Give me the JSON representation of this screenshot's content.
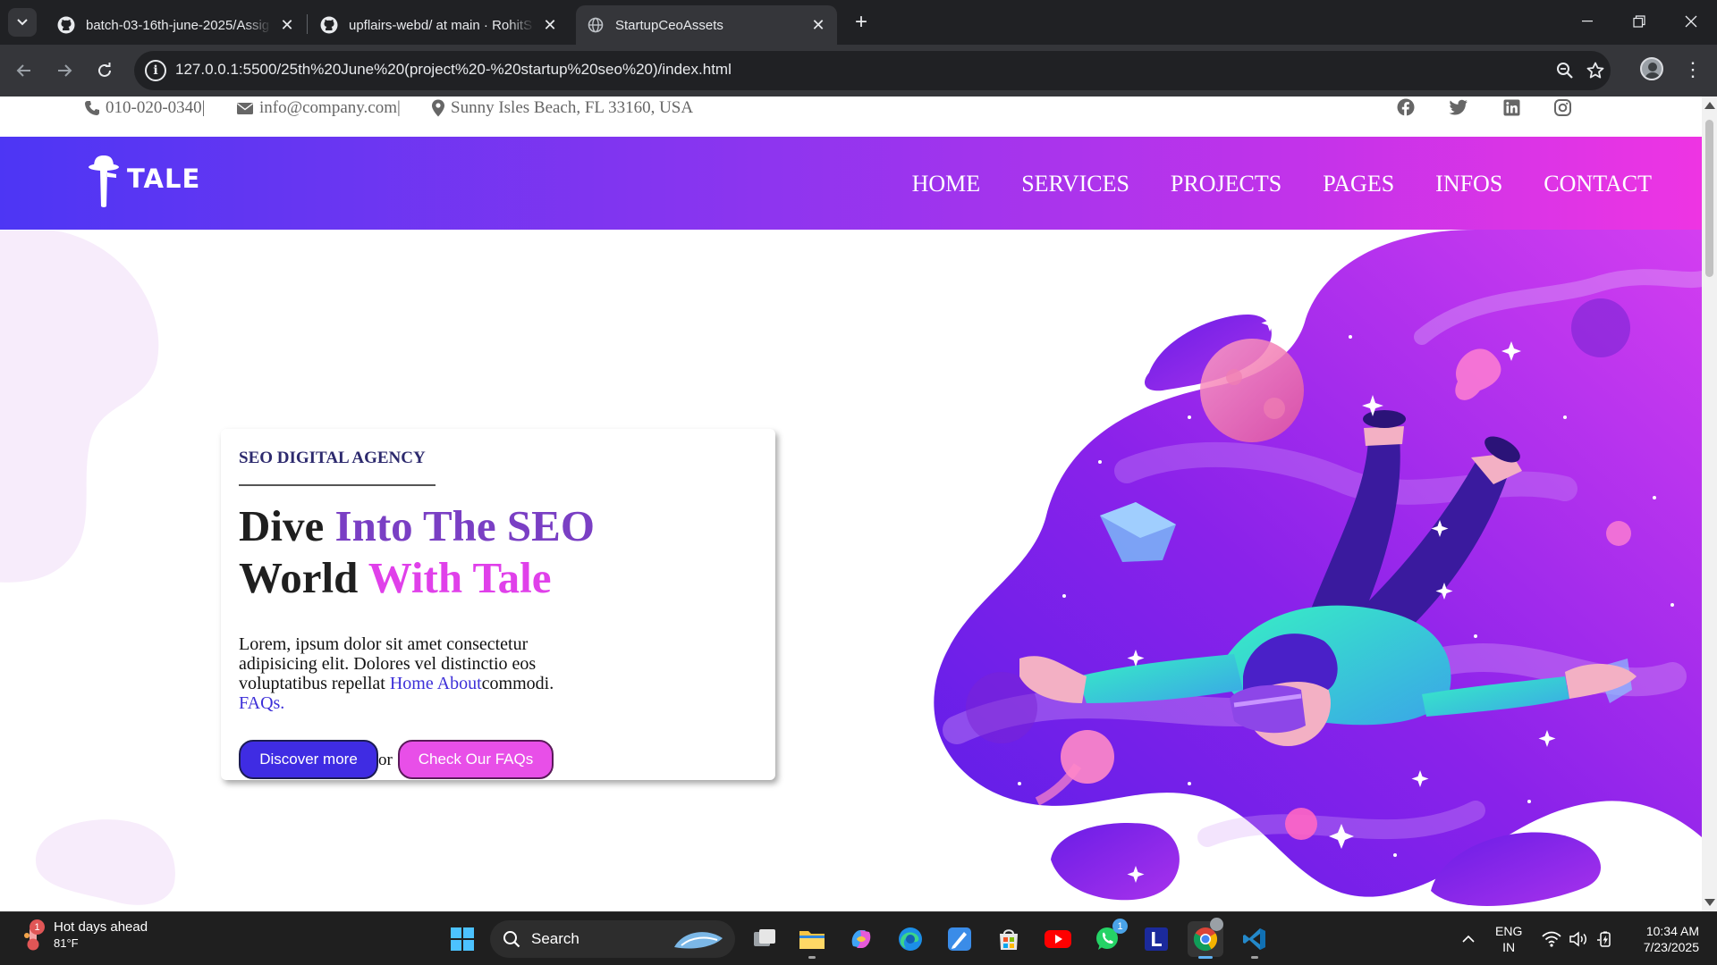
{
  "browser": {
    "tabs": [
      {
        "title": "batch-03-16th-june-2025/Assig",
        "active": false
      },
      {
        "title": "upflairs-webd/ at main · RohitS",
        "active": false
      },
      {
        "title": "StartupCeoAssets",
        "active": true
      }
    ],
    "url": "127.0.0.1:5500/25th%20June%20(project%20-%20startup%20seo%20)/index.html"
  },
  "page": {
    "topbar": {
      "phone": "010-020-0340|",
      "email": "info@company.com|",
      "address": "Sunny Isles Beach, FL 33160, USA",
      "social_icons": [
        "facebook-icon",
        "twitter-icon",
        "linkedin-icon",
        "instagram-icon"
      ]
    },
    "nav": {
      "logo_text": "TALE",
      "items": [
        "HOME",
        "SERVICES",
        "PROJECTS",
        "PAGES",
        "INFOS",
        "CONTACT"
      ],
      "gradient": [
        "#4d36f4",
        "#ee34e3"
      ]
    },
    "hero": {
      "eyebrow": "SEO DIGITAL AGENCY",
      "headline_1a": "Dive ",
      "headline_1b": "Into The SEO",
      "headline_2a": "World ",
      "headline_2b": "With Tale",
      "paragraph": "Lorem, ipsum dolor sit amet consectetur adipisicing elit. Dolores vel distinctio eos voluptatibus repellat",
      "link_home_about": "Home About",
      "paragraph_mid": "commodi. ",
      "link_faqs": "FAQs.",
      "btn_discover": "Discover more",
      "or_text": "or",
      "btn_faq": "Check Our FAQs"
    },
    "colors": {
      "purple": "#7a3fc4",
      "pink": "#e040ea",
      "button_blue": "#3f2ce3",
      "button_pink": "#e84fe8"
    }
  },
  "taskbar": {
    "weather_title": "Hot days ahead",
    "weather_temp": "81°F",
    "weather_badge": "1",
    "search_label": "Search",
    "whatsapp_badge": "1",
    "lang_1": "ENG",
    "lang_2": "IN",
    "time": "10:34 AM",
    "date": "7/23/2025"
  }
}
